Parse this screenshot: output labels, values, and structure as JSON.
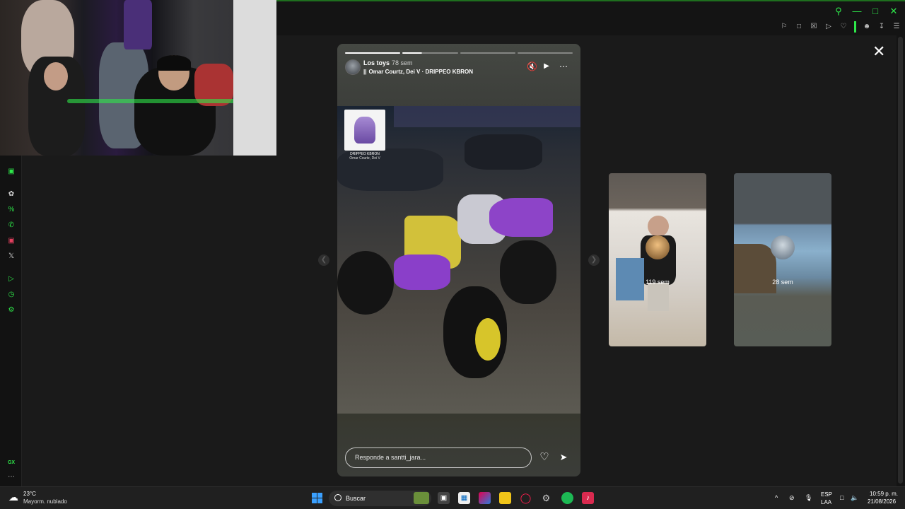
{
  "story": {
    "username": "Los toys",
    "time_ago": "78 sem",
    "music": "Omar Courtz, Dei V · DRIPPEO KBRON",
    "album_title": "DRIPPEO KBRON",
    "album_artist": "Omar Courtz, Dei V",
    "reply_placeholder": "Responde a santti_jara...",
    "progress": {
      "total_segments": 4,
      "completed": 1,
      "current_fraction": 0.35
    }
  },
  "other_stories": [
    {
      "time_ago": "119 sem"
    },
    {
      "time_ago": "28 sem"
    }
  ],
  "taskbar": {
    "weather_temp": "23°C",
    "weather_desc": "Mayorm. nublado",
    "search_label": "Buscar",
    "lang_line1": "ESP",
    "lang_line2": "LAA",
    "clock_time": "10:59 p. m.",
    "clock_date": "21/08/2026"
  },
  "sidebar": {
    "gx_label": "GX",
    "icons": [
      "gamepad-icon",
      "chatgpt-icon",
      "percent-icon",
      "whatsapp-icon",
      "instagram-icon",
      "x-icon",
      "play-icon",
      "history-icon",
      "settings-icon"
    ]
  },
  "colors": {
    "accent": "#2ee84a",
    "background": "#1a1a1a",
    "taskbar": "#202020"
  }
}
